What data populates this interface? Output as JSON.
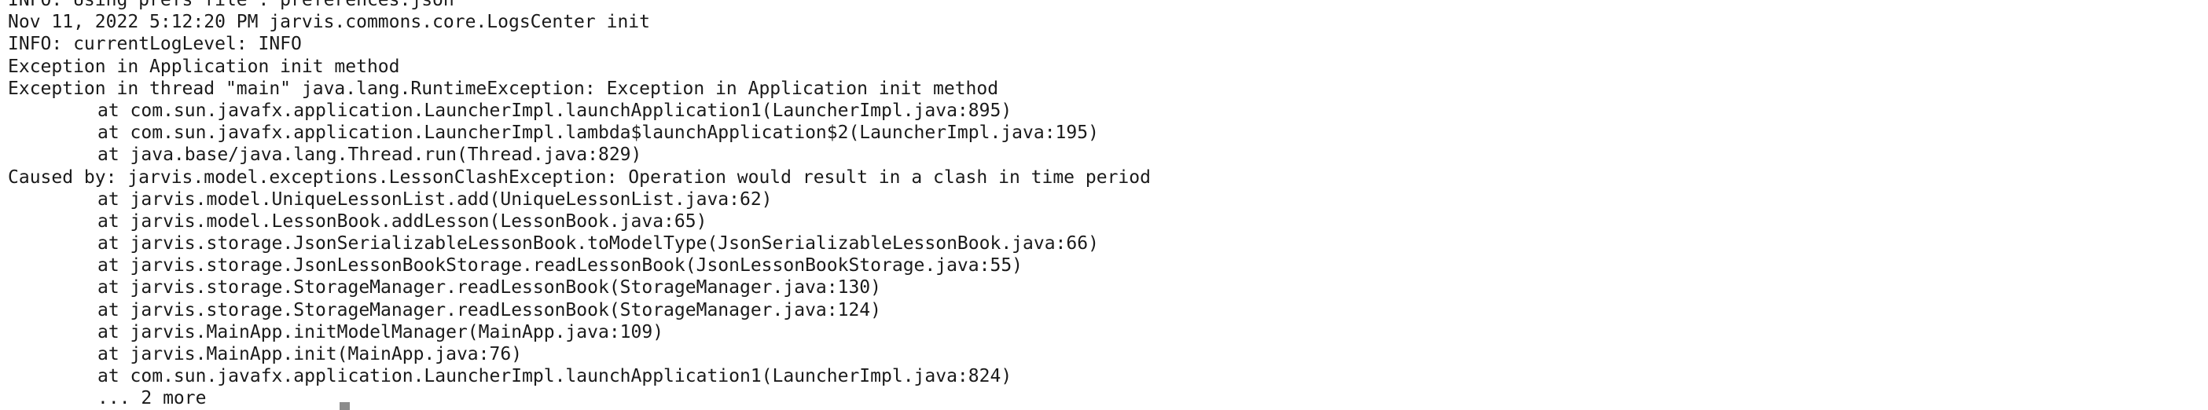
{
  "terminal": {
    "lines": [
      {
        "text": "INFO: Using prefs file : preferences.json",
        "indent": false
      },
      {
        "text": "Nov 11, 2022 5:12:20 PM jarvis.commons.core.LogsCenter init",
        "indent": false
      },
      {
        "text": "INFO: currentLogLevel: INFO",
        "indent": false
      },
      {
        "text": "Exception in Application init method",
        "indent": false
      },
      {
        "text": "Exception in thread \"main\" java.lang.RuntimeException: Exception in Application init method",
        "indent": false
      },
      {
        "text": "at com.sun.javafx.application.LauncherImpl.launchApplication1(LauncherImpl.java:895)",
        "indent": true
      },
      {
        "text": "at com.sun.javafx.application.LauncherImpl.lambda$launchApplication$2(LauncherImpl.java:195)",
        "indent": true
      },
      {
        "text": "at java.base/java.lang.Thread.run(Thread.java:829)",
        "indent": true
      },
      {
        "text": "Caused by: jarvis.model.exceptions.LessonClashException: Operation would result in a clash in time period",
        "indent": false
      },
      {
        "text": "at jarvis.model.UniqueLessonList.add(UniqueLessonList.java:62)",
        "indent": true
      },
      {
        "text": "at jarvis.model.LessonBook.addLesson(LessonBook.java:65)",
        "indent": true
      },
      {
        "text": "at jarvis.storage.JsonSerializableLessonBook.toModelType(JsonSerializableLessonBook.java:66)",
        "indent": true
      },
      {
        "text": "at jarvis.storage.JsonLessonBookStorage.readLessonBook(JsonLessonBookStorage.java:55)",
        "indent": true
      },
      {
        "text": "at jarvis.storage.StorageManager.readLessonBook(StorageManager.java:130)",
        "indent": true
      },
      {
        "text": "at jarvis.storage.StorageManager.readLessonBook(StorageManager.java:124)",
        "indent": true
      },
      {
        "text": "at jarvis.MainApp.initModelManager(MainApp.java:109)",
        "indent": true
      },
      {
        "text": "at jarvis.MainApp.init(MainApp.java:76)",
        "indent": true
      },
      {
        "text": "at com.sun.javafx.application.LauncherImpl.launchApplication1(LauncherImpl.java:824)",
        "indent": true
      },
      {
        "text": "... 2 more",
        "indent": true
      }
    ]
  }
}
